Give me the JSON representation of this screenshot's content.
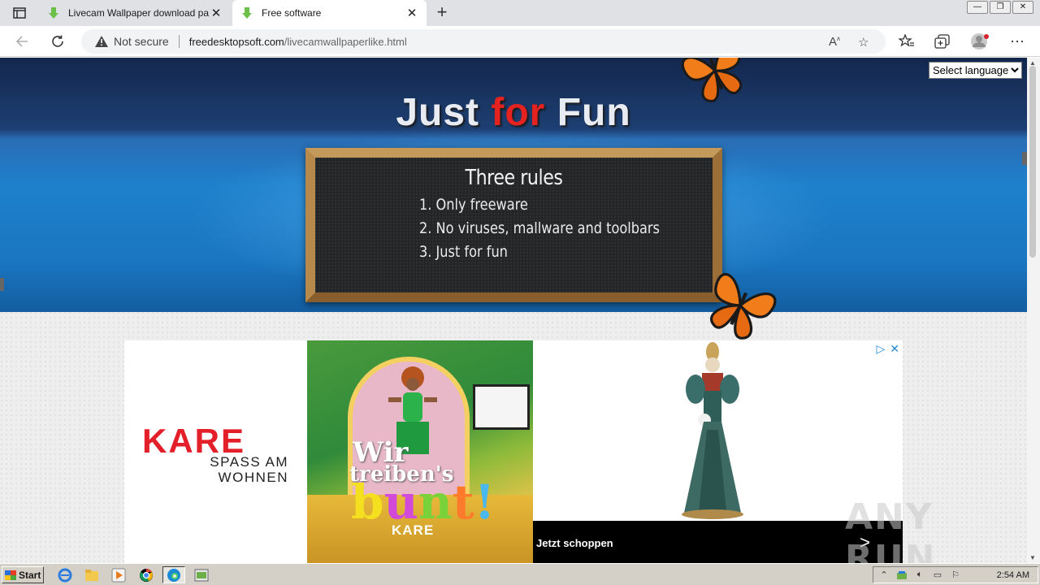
{
  "browser": {
    "tabs": [
      {
        "title": "Livecam Wallpaper download pa",
        "active": false
      },
      {
        "title": "Free software",
        "active": true
      }
    ],
    "new_tab": "+",
    "window_controls": {
      "minimize": "—",
      "restore": "❐",
      "close": "✕"
    },
    "address": {
      "security_label": "Not secure",
      "host": "freedesktopsoft.com",
      "path": "/livecamwallpaperlike.html"
    },
    "icons": [
      "back-icon",
      "refresh-icon",
      "read-aloud-icon",
      "add-favorite-icon",
      "favorites-icon",
      "collections-icon",
      "profile-icon",
      "more-icon"
    ]
  },
  "page": {
    "title_prefix": "Just ",
    "title_accent": "for",
    "title_suffix": " Fun",
    "accent_color": "#e42220",
    "language_select": "Select language",
    "chalkboard": {
      "heading": "Three rules",
      "rules": [
        "1. Only freeware",
        "2. No viruses, mallware and toolbars",
        "3. Just for fun"
      ]
    },
    "ad": {
      "brand": "KARE",
      "tagline_line1": "SPASS AM",
      "tagline_line2": "WOHNEN",
      "slogan_line1": "Wir",
      "slogan_line2": "treiben's",
      "slogan_line3_letters": [
        "b",
        "u",
        "n",
        "t",
        "!"
      ],
      "photo_brand": "KARE",
      "cta": "Jetzt schoppen",
      "cta_arrow": ">",
      "adchoices_icon": "▷",
      "close_icon": "✕",
      "brand_color": "#e3202a"
    },
    "watermark": "ANY RUN"
  },
  "taskbar": {
    "start_label": "Start",
    "clock": "2:54 AM",
    "apps": [
      "ie-icon",
      "explorer-icon",
      "media-player-icon",
      "chrome-icon",
      "edge-icon",
      "app-icon"
    ]
  }
}
